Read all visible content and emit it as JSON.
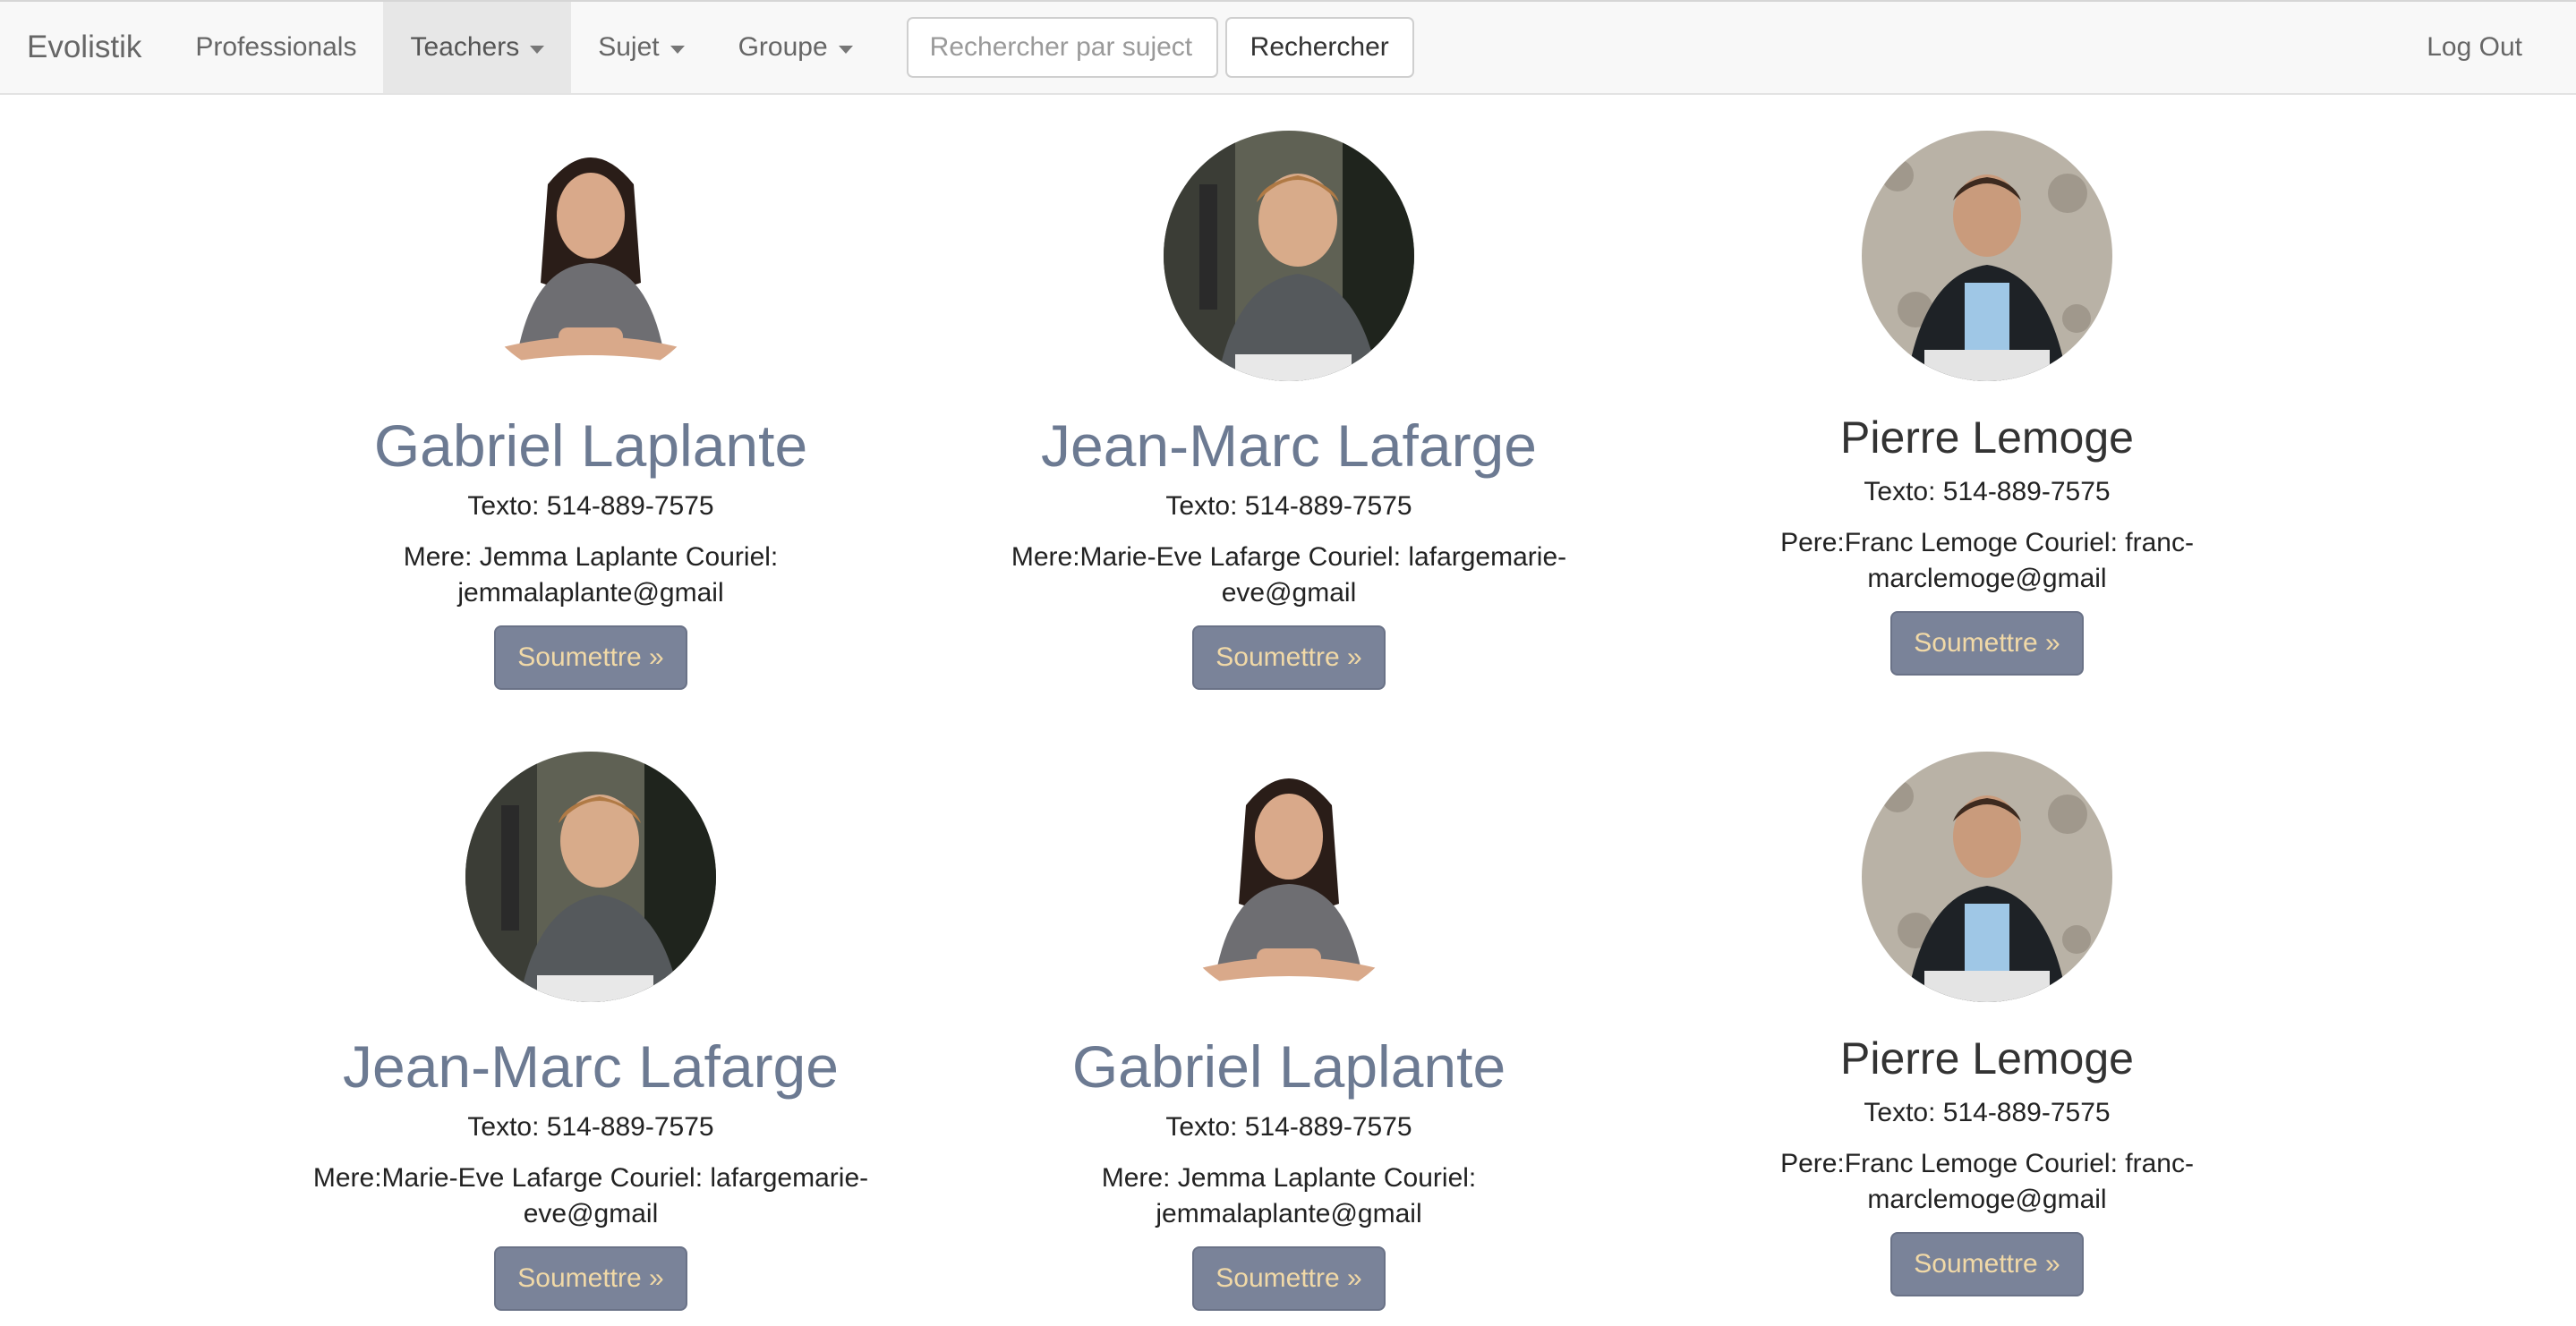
{
  "navbar": {
    "brand": "Evolistik",
    "items": [
      {
        "label": "Professionals",
        "dropdown": false,
        "active": false
      },
      {
        "label": "Teachers",
        "dropdown": true,
        "active": true
      },
      {
        "label": "Sujet",
        "dropdown": true,
        "active": false
      },
      {
        "label": "Groupe",
        "dropdown": true,
        "active": false
      }
    ],
    "search": {
      "placeholder": "Rechercher par suject / prof",
      "button_label": "Rechercher"
    },
    "logout_label": "Log Out"
  },
  "cards": [
    {
      "name": "Gabriel Laplante",
      "phone": "Texto: 514-889-7575",
      "contact": "Mere: Jemma Laplante Couriel: jemmalaplante@gmail",
      "button": "Soumettre »",
      "photo": "girl-cutout"
    },
    {
      "name": "Jean-Marc Lafarge",
      "phone": "Texto: 514-889-7575",
      "contact": "Mere:Marie-Eve Lafarge Couriel: lafargemarie-eve@gmail",
      "button": "Soumettre »",
      "photo": "boy-outdoor"
    },
    {
      "name": "Pierre Lemoge",
      "phone": "Texto: 514-889-7575",
      "contact": "Pere:Franc Lemoge Couriel: franc-marclemoge@gmail",
      "button": "Soumettre »",
      "photo": "boy-wall"
    },
    {
      "name": "Jean-Marc Lafarge",
      "phone": "Texto: 514-889-7575",
      "contact": "Mere:Marie-Eve Lafarge Couriel: lafargemarie-eve@gmail",
      "button": "Soumettre »",
      "photo": "boy-outdoor"
    },
    {
      "name": "Gabriel Laplante",
      "phone": "Texto: 514-889-7575",
      "contact": "Mere: Jemma Laplante Couriel: jemmalaplante@gmail",
      "button": "Soumettre »",
      "photo": "girl-cutout"
    },
    {
      "name": "Pierre Lemoge",
      "phone": "Texto: 514-889-7575",
      "contact": "Pere:Franc Lemoge Couriel: franc-marclemoge@gmail",
      "button": "Soumettre »",
      "photo": "boy-wall"
    }
  ]
}
